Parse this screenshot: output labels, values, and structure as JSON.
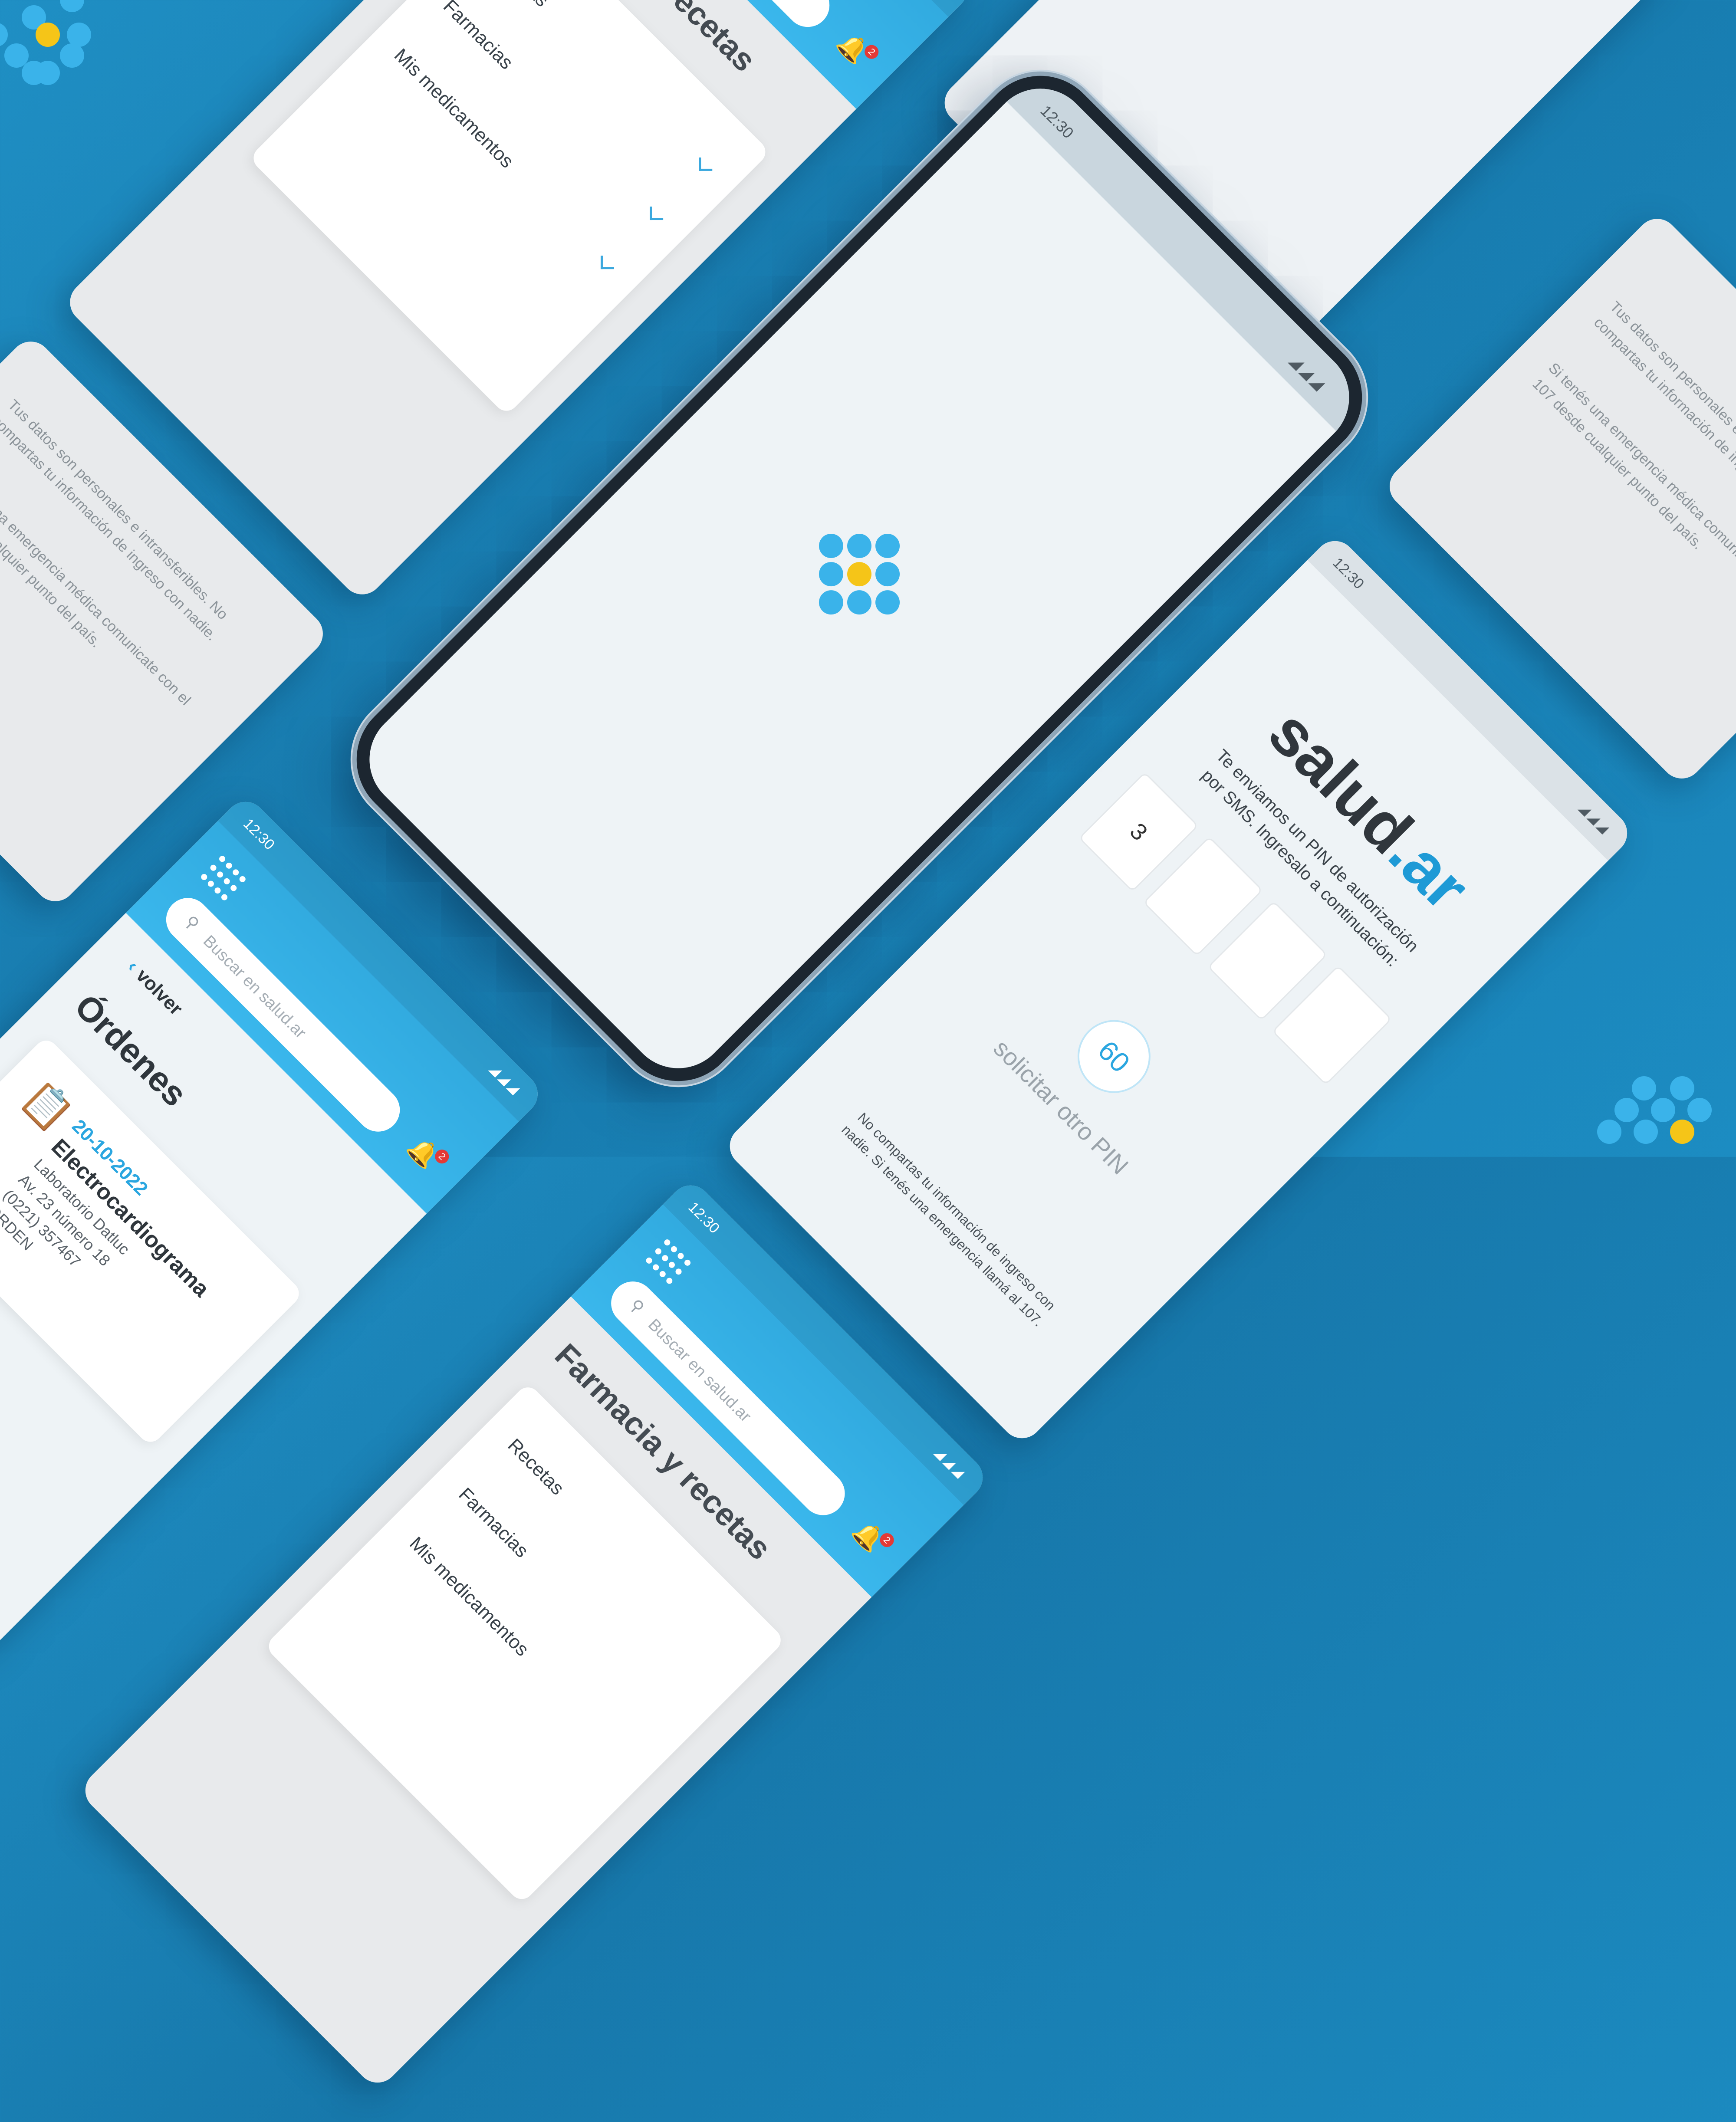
{
  "status": {
    "time": "12:30",
    "signal": "◢◢◢"
  },
  "search": {
    "placeholder": "Buscar en salud.ar",
    "magnifier": "⚲"
  },
  "notifications": {
    "count": "2"
  },
  "pharmacy": {
    "title": "Farmacia y recetas",
    "items": [
      "Recetas",
      "Farmacias",
      "Mis medicamentos"
    ]
  },
  "privacy": {
    "line1": "Tus datos son personales e intransferibles. No compartas tu información de ingreso con nadie.",
    "line2": "Si tenés una emergencia médica comunicate con el 107 desde cualquier punto del país."
  },
  "pin": {
    "brand_main": "salud",
    "brand_suffix": ".ar",
    "message": "Te enviamos un PIN de autorización por SMS. Ingresalo a continuación:",
    "digit1": "3",
    "timer": "60",
    "resend": "solicitar otro PIN",
    "footer": "No compartas tu información de ingreso con nadie. Si tenés una emergencia llamá al 107."
  },
  "orders": {
    "back": "volver",
    "title": "Órdenes",
    "date": "20-10-2022",
    "name": "Electrocardiograma",
    "lab": "Laboratorio Datluc",
    "address": "Av. 23 número 18",
    "phone": "(0221) 357467",
    "order_label": "ORDEN"
  },
  "colors": {
    "brand_blue": "#3ab3ea",
    "accent_yellow": "#f5c518",
    "background": "#1778ab"
  }
}
